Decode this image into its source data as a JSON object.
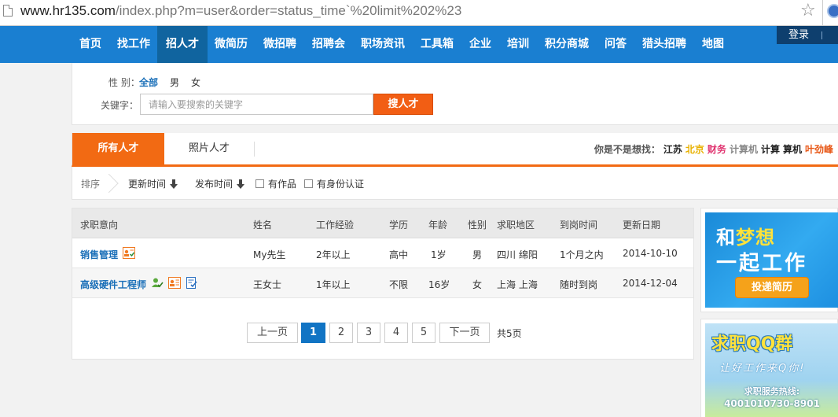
{
  "browser": {
    "url_domain": "www.hr135.com",
    "url_rest": "/index.php?m=user&order=status_time`%20limit%202%23"
  },
  "nav": {
    "items": [
      "首页",
      "找工作",
      "招人才",
      "微简历",
      "微招聘",
      "招聘会",
      "职场资讯",
      "工具箱",
      "企业",
      "培训",
      "积分商城",
      "问答",
      "猎头招聘",
      "地图"
    ],
    "active_index": 2,
    "login": "登录"
  },
  "filter": {
    "gender_label": "性 别：",
    "gender_options": [
      "全部",
      "男",
      "女"
    ],
    "keyword_label": "关键字：",
    "keyword_placeholder": "请输入要搜索的关键字",
    "search_button": "搜人才"
  },
  "tabs": {
    "items": [
      "所有人才",
      "照片人才"
    ],
    "suggest_label": "你是不是想找：",
    "suggest_keywords": [
      {
        "text": "江苏",
        "color": "#222222"
      },
      {
        "text": "北京",
        "color": "#e8b100"
      },
      {
        "text": "财务",
        "color": "#e0336f"
      },
      {
        "text": "计算机",
        "color": "#888888"
      },
      {
        "text": "计算",
        "color": "#222222"
      },
      {
        "text": "算机",
        "color": "#222222"
      },
      {
        "text": "叶劲峰",
        "color": "#e85a1a"
      }
    ]
  },
  "sortbar": {
    "label": "排序",
    "sort_update": "更新时间",
    "sort_publish": "发布时间",
    "check_works": "有作品",
    "check_id": "有身份认证"
  },
  "table": {
    "headers": [
      "求职意向",
      "姓名",
      "工作经验",
      "学历",
      "年龄",
      "性别",
      "求职地区",
      "到岗时间",
      "更新日期"
    ],
    "rows": [
      {
        "job": "销售管理",
        "name": "My先生",
        "experience": "2年以上",
        "education": "高中",
        "age": "1岁",
        "gender": "男",
        "region": "四川 绵阳",
        "arrival": "1个月之内",
        "date": "2014-10-10",
        "badges": [
          "photo-id-icon"
        ]
      },
      {
        "job": "高级硬件工程师",
        "name": "王女士",
        "experience": "1年以上",
        "education": "不限",
        "age": "16岁",
        "gender": "女",
        "region": "上海 上海",
        "arrival": "随时到岗",
        "date": "2014-12-04",
        "badges": [
          "verified-user-icon",
          "photo-id-icon",
          "resume-check-icon"
        ]
      }
    ]
  },
  "pagination": {
    "prev": "上一页",
    "pages": [
      "1",
      "2",
      "3",
      "4",
      "5"
    ],
    "current": "1",
    "next": "下一页",
    "total": "共5页"
  },
  "ads": {
    "ad1_line1_a": "和",
    "ad1_line1_b": "梦想",
    "ad1_line2": "一起工作",
    "ad1_cta": "投递简历",
    "ad2_title": "求职QQ群",
    "ad2_slogan": "让好工作来Q你!",
    "ad2_hotline_label": "求职服务热线:",
    "ad2_hotline": "4001010730-8901"
  },
  "colors": {
    "nav_blue": "#1a7fd1",
    "accent_orange": "#f26a13",
    "link_blue": "#1a6fb8",
    "page_current": "#1174c4"
  }
}
